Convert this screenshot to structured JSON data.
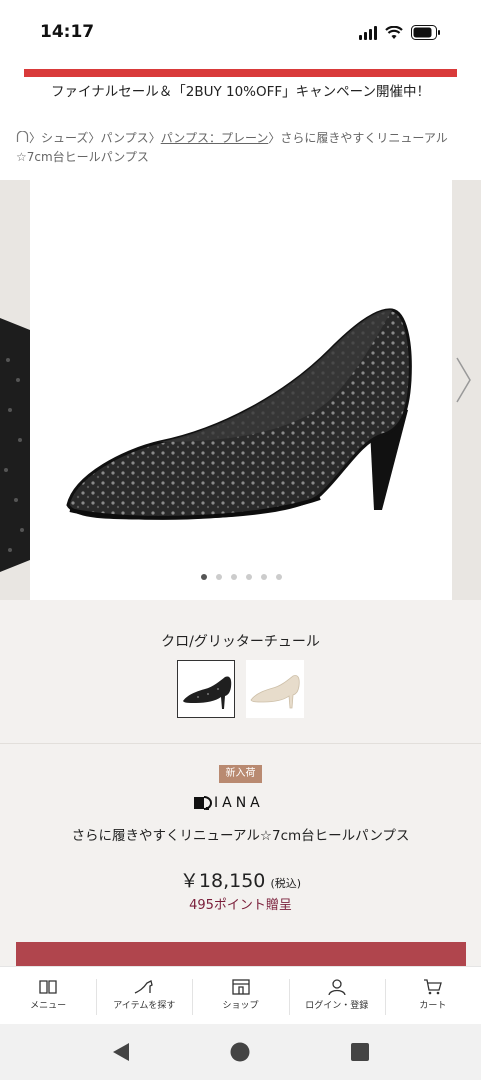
{
  "status_bar": {
    "time": "14:17"
  },
  "banner": {
    "text": "ファイナルセール＆「2BUY 10%OFF」キャンペーン開催中！",
    "accent_color": "#d93a3a"
  },
  "breadcrumb": {
    "items": [
      "シューズ",
      "パンプス",
      "パンプス：プレーン",
      "さらに履きやすくリニューアル☆7cm台ヒールパンプス"
    ],
    "separator": "〉"
  },
  "gallery": {
    "image_count": 6,
    "active_index": 0
  },
  "color": {
    "label": "クロ/グリッターチュール",
    "swatches": [
      "black-glitter-tulle",
      "beige-lace"
    ],
    "selected_index": 0
  },
  "product": {
    "badge": "新入荷",
    "brand": "IANA",
    "name": "さらに履きやすくリニューアル☆7cm台ヒールパンプス",
    "price": "￥18,150",
    "tax": "(税込)",
    "points": "495ポイント贈呈",
    "cart_button_color": "#b0454d"
  },
  "bottom_nav": {
    "items": [
      {
        "label": "メニュー",
        "icon": "book-icon"
      },
      {
        "label": "アイテムを探す",
        "icon": "heel-shoe-icon"
      },
      {
        "label": "ショップ",
        "icon": "shop-icon"
      },
      {
        "label": "ログイン・登録",
        "icon": "user-icon"
      },
      {
        "label": "カート",
        "icon": "cart-icon"
      }
    ]
  }
}
